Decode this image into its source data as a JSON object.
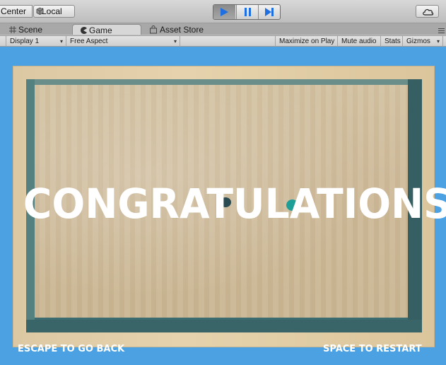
{
  "toolbar": {
    "pivot_label": "Center",
    "space_label": "Local",
    "play_icon": "play-icon",
    "pause_icon": "pause-icon",
    "step_icon": "step-icon",
    "cloud_icon": "cloud-icon",
    "play_active_color": "#1f6fe0"
  },
  "tabs": [
    {
      "label": "Scene",
      "icon": "grid-icon"
    },
    {
      "label": "Game",
      "icon": "pacman-icon",
      "active": true
    },
    {
      "label": "Asset Store",
      "icon": "shopping-bag-icon"
    }
  ],
  "game_bar": {
    "display": "Display 1",
    "aspect": "Free Aspect",
    "maximize": "Maximize on Play",
    "mute": "Mute audio",
    "stats": "Stats",
    "gizmos": "Gizmos"
  },
  "game": {
    "headline": "CONGRATULATIONS",
    "hint_left": "ESCAPE TO GO BACK",
    "hint_right": "SPACE TO RESTART",
    "background_color": "#4ba1e2"
  }
}
